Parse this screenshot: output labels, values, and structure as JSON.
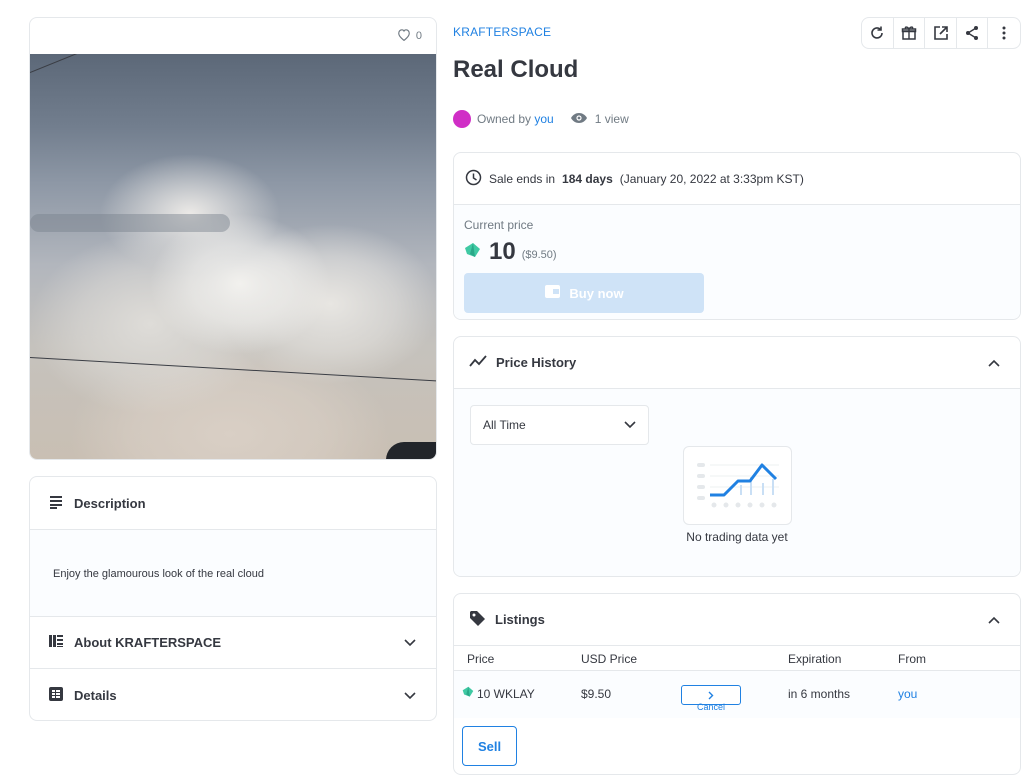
{
  "media": {
    "favorites_count": "0",
    "image_alt": "Cloud photograph"
  },
  "info": {
    "description_title": "Description",
    "description_text": "Enjoy the glamourous look of the real cloud",
    "about_title": "About KRAFTERSPACE",
    "details_title": "Details"
  },
  "header": {
    "collection": "KRAFTERSPACE",
    "title": "Real Cloud",
    "owned_by_label": "Owned by",
    "owner": "you",
    "views": "1 view"
  },
  "toolbar": {
    "icons": [
      "refresh-icon",
      "gift-icon",
      "external-link-icon",
      "share-icon",
      "more-icon"
    ]
  },
  "sale": {
    "ends_prefix": "Sale ends in",
    "ends_days": "184 days",
    "ends_date": "(January 20, 2022 at 3:33pm KST)",
    "current_price_label": "Current price",
    "price": "10",
    "price_usd": "($9.50)",
    "buy_label": "Buy now"
  },
  "price_history": {
    "title": "Price History",
    "range_value": "All Time",
    "empty_text": "No trading data yet"
  },
  "listings": {
    "title": "Listings",
    "columns": [
      "Price",
      "USD Price",
      "Expiration",
      "From"
    ],
    "rows": [
      {
        "price": "10 WKLAY",
        "usd": "$9.50",
        "action": "Cancel",
        "expiration": "in 6 months",
        "from": "you"
      }
    ],
    "sell_label": "Sell"
  },
  "colors": {
    "accent": "#2081e2",
    "owner_avatar": "#d02ec6",
    "klay_token": "#3fc9a3"
  }
}
